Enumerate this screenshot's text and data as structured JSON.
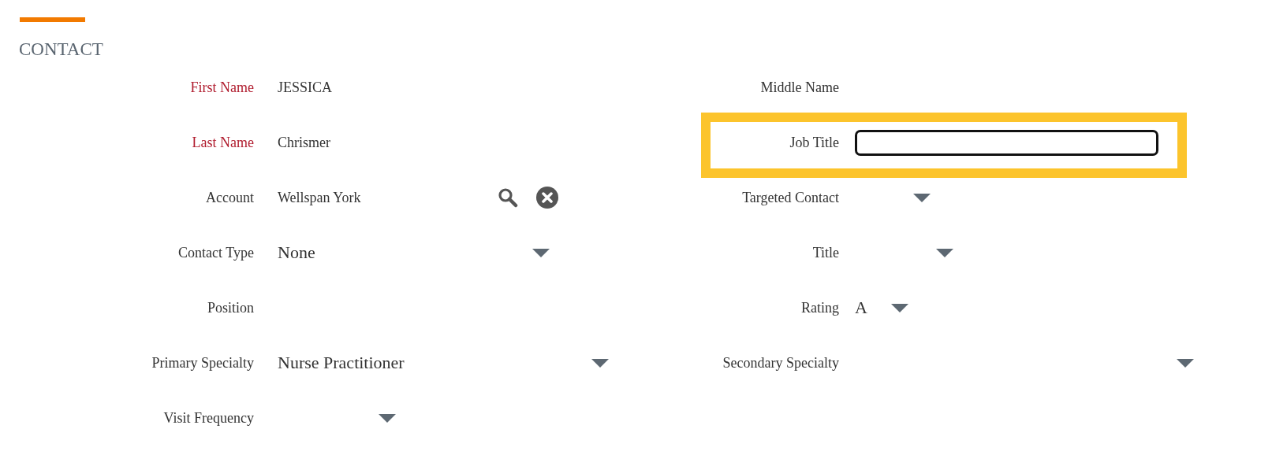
{
  "section": {
    "title": "CONTACT"
  },
  "fields": [
    {
      "label": "First Name",
      "required": true,
      "kind": "text",
      "value": "JESSICA"
    },
    {
      "label": "Middle Name",
      "required": false,
      "kind": "text"
    },
    {
      "label": "Last Name",
      "required": true,
      "kind": "text",
      "value": "Chrismer"
    },
    {
      "label": "Job Title",
      "required": false,
      "kind": "input",
      "highlighted": true
    },
    {
      "label": "Account",
      "required": false,
      "kind": "lookup",
      "value": "Wellspan York"
    },
    {
      "label": "Targeted Contact",
      "required": false,
      "kind": "select"
    },
    {
      "label": "Contact Type",
      "required": false,
      "kind": "select",
      "value": "None"
    },
    {
      "label": "Title",
      "required": false,
      "kind": "select"
    },
    {
      "label": "Position",
      "required": false,
      "kind": "text"
    },
    {
      "label": "Rating",
      "required": false,
      "kind": "select",
      "value": "A"
    },
    {
      "label": "Primary Specialty",
      "required": false,
      "kind": "select",
      "value": "Nurse Practitioner"
    },
    {
      "label": "Secondary Specialty",
      "required": false,
      "kind": "select"
    },
    {
      "label": "Visit Frequency",
      "required": false,
      "kind": "select"
    }
  ]
}
